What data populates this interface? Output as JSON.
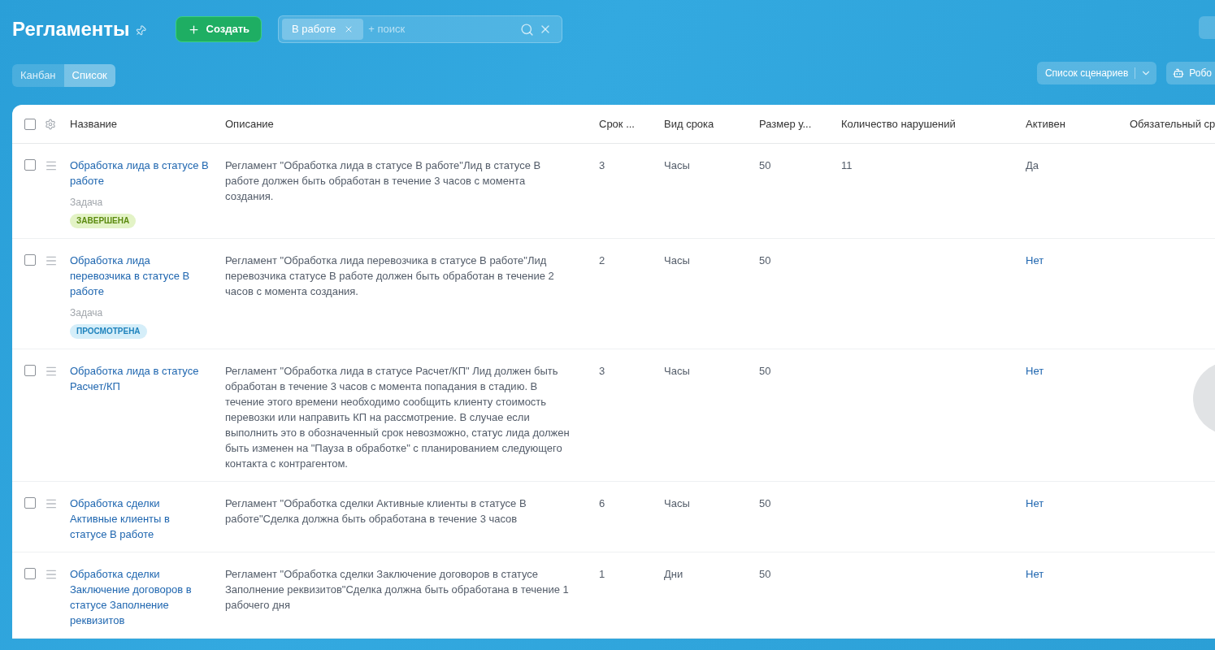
{
  "header": {
    "title": "Регламенты",
    "create_button": "Создать",
    "search": {
      "chip": "В работе",
      "placeholder": "+ поиск"
    }
  },
  "view_toggle": [
    {
      "label": "Канбан",
      "selected": false
    },
    {
      "label": "Список",
      "selected": true
    }
  ],
  "toolbar": {
    "scenarios_button": "Список сценариев",
    "robots_button": "Робо"
  },
  "table": {
    "select_all_checked": false,
    "columns": [
      "Название",
      "Описание",
      "Срок ...",
      "Вид срока",
      "Размер у...",
      "Количество нарушений",
      "Активен",
      "Обязательный ср"
    ],
    "rows": [
      {
        "checked": false,
        "name": "Обработка лида в статусе В работе",
        "type": "Задача",
        "tag": {
          "text": "ЗАВЕРШЕНА",
          "kind": "done"
        },
        "description": "Регламент \"Обработка лида в статусе В работе\"Лид в статусе В работе должен быть обработан в течение 3 часов с момента создания.",
        "term": "3",
        "term_kind": "Часы",
        "size": "50",
        "violations": "11",
        "active": {
          "text": "Да",
          "link": false
        }
      },
      {
        "checked": false,
        "name": "Обработка лида перевозчика в статусе В работе",
        "type": "Задача",
        "tag": {
          "text": "ПРОСМОТРЕНА",
          "kind": "viewed"
        },
        "description": "Регламент \"Обработка лида перевозчика в статусе В работе\"Лид перевозчика статусе В работе должен быть обработан в течение 2 часов с момента создания.",
        "term": "2",
        "term_kind": "Часы",
        "size": "50",
        "active": {
          "text": "Нет",
          "link": true
        }
      },
      {
        "checked": false,
        "name": "Обработка лида в статусе Расчет/КП",
        "description": "Регламент \"Обработка лида в статусе Расчет/КП\" Лид должен быть обработан в течение 3 часов с момента попадания в стадию. В течение этого времени необходимо сообщить клиенту стоимость перевозки или направить КП на рассмотрение. В случае если выполнить это в обозначенный срок невозможно, статус лида должен быть изменен на \"Пауза в обработке\" с планированием следующего контакта с контрагентом.",
        "term": "3",
        "term_kind": "Часы",
        "size": "50",
        "active": {
          "text": "Нет",
          "link": true
        }
      },
      {
        "checked": false,
        "name": "Обработка сделки Активные клиенты в статусе В работе",
        "description": "Регламент \"Обработка сделки Активные клиенты в статусе В работе\"Сделка должна быть обработана в течение 3 часов",
        "term": "6",
        "term_kind": "Часы",
        "size": "50",
        "active": {
          "text": "Нет",
          "link": true
        }
      },
      {
        "checked": false,
        "name": "Обработка сделки Заключение договоров в статусе Заполнение реквизитов",
        "description": "Регламент \"Обработка сделки Заключение договоров в статусе Заполнение реквизитов\"Сделка должна быть обработана в течение 1 рабочего дня",
        "term": "1",
        "term_kind": "Дни",
        "size": "50",
        "active": {
          "text": "Нет",
          "link": true
        }
      }
    ]
  }
}
